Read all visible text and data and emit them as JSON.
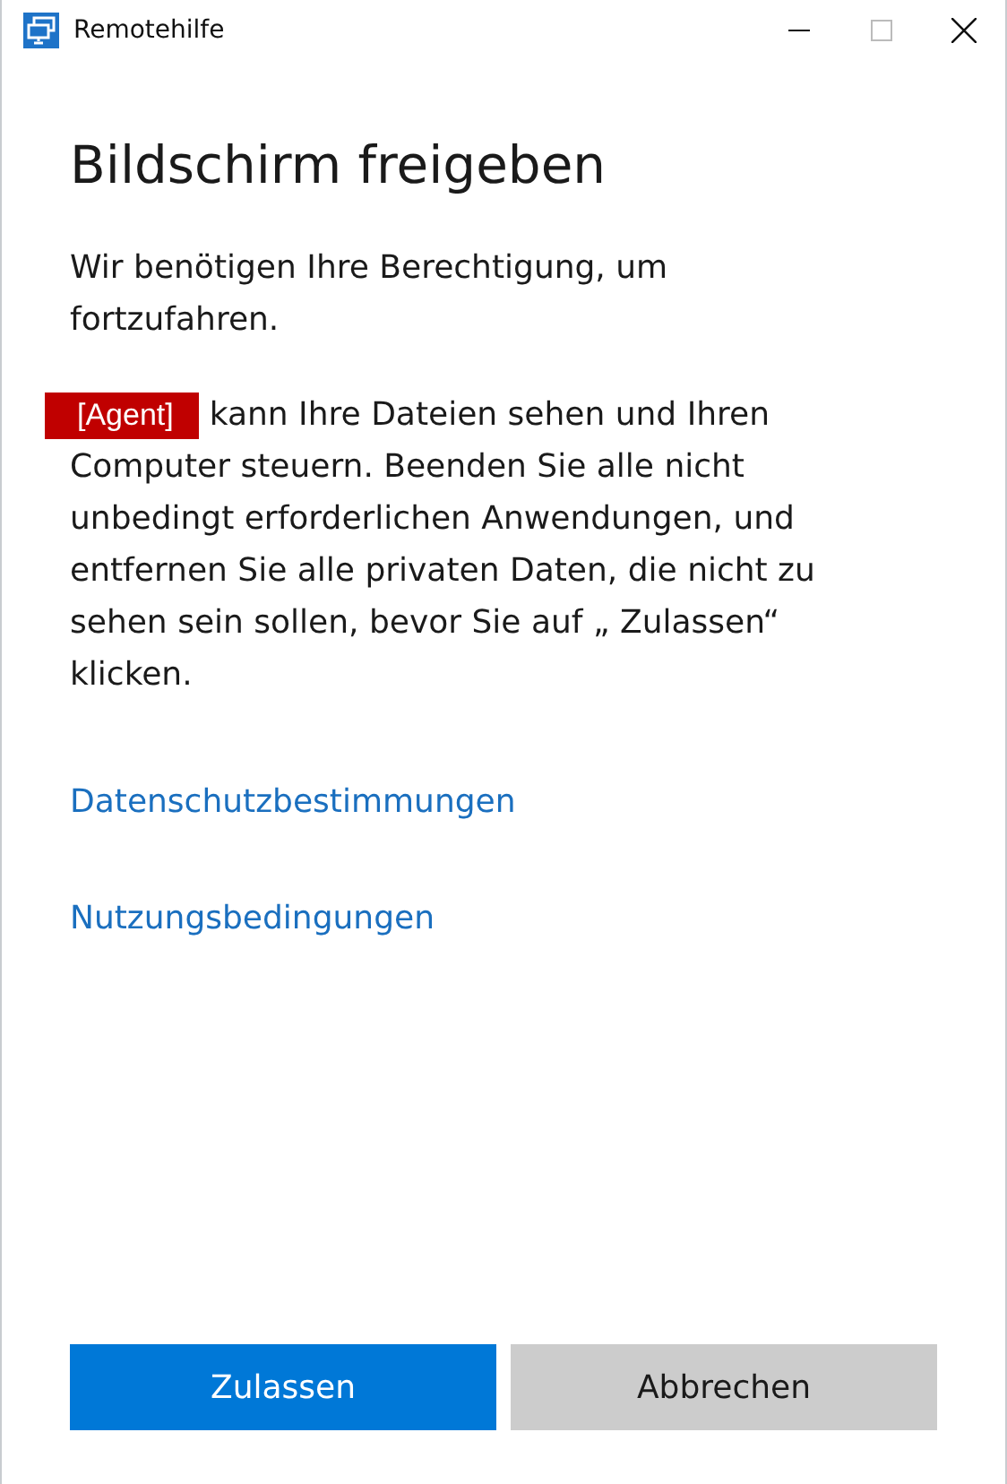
{
  "window": {
    "title": "Remotehilfe"
  },
  "heading": "Bildschirm freigeben",
  "intro": "Wir benötigen Ihre Berechtigung, um fortzufahren.",
  "agent_tag": "[Agent]",
  "consent_text": [
    "kann Ihre Dateien sehen und Ihren",
    "Computer steuern. Beenden Sie alle nicht unbedingt erforderlichen Anwendungen, und entfernen Sie alle privaten Daten, die nicht zu sehen sein sollen, bevor Sie auf „ Zulassen“ klicken."
  ],
  "links": [
    "Datenschutzbestimmungen",
    "Nutzungsbedingungen"
  ],
  "buttons": [
    {
      "label": "Zulassen",
      "kind": "primary"
    },
    {
      "label": "Abbrechen",
      "kind": "secondary"
    }
  ]
}
